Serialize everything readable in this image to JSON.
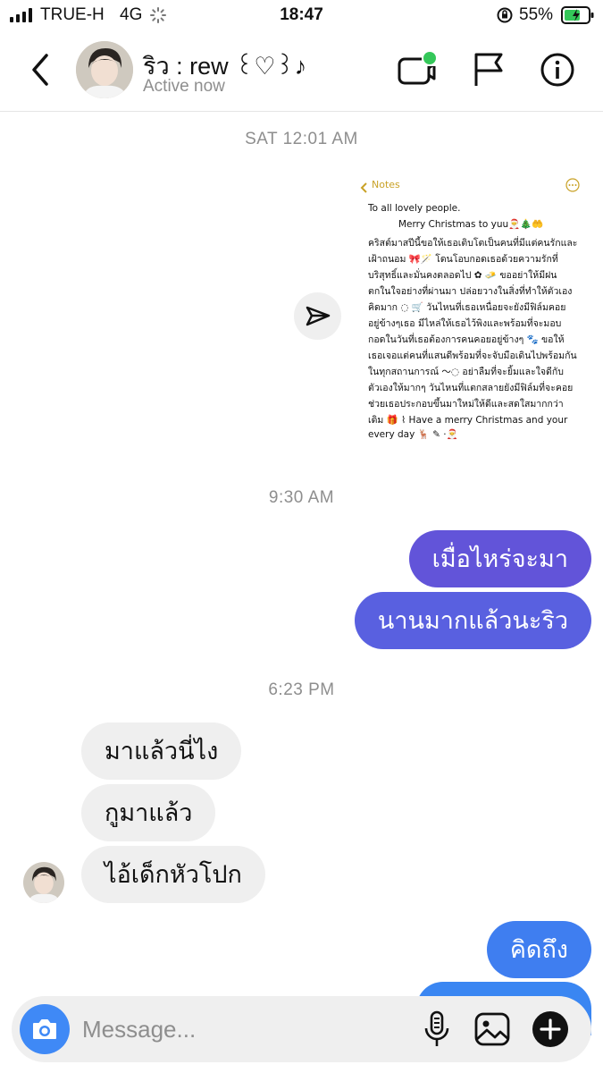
{
  "status_bar": {
    "carrier": "TRUE-H",
    "network": "4G",
    "time": "18:47",
    "battery": "55%"
  },
  "header": {
    "contact_name": "ริว : rew ꒰♡꒱♪",
    "status": "Active now"
  },
  "conversation": {
    "stamp_1": "SAT 12:01 AM",
    "shared_note": {
      "app_back_label": "Notes",
      "lines": [
        "To all lovely people.",
        "Merry Christmas to yuu🎅🎄🤲",
        "คริสต์มาสปีนี้ขอให้เธอเติบโตเป็นคนที่มีแต่คนรักและ",
        "เฝ้าถนอม 🎀🪄 โดนโอบกอดเธอด้วยความรักที่",
        "บริสุทธิ์และมั่นคงตลอดไป ✿ 🧈 ขออย่าให้มีฝน",
        "ตกในใจอย่างที่ผ่านมา ปล่อยวางในสิ่งที่ทำให้ตัวเอง",
        "คิดมาก ◌ 🛒 วันไหนที่เธอเหนื่อยจะยังมีฟิล์มคอย",
        "อยู่ข้างๆเธอ มีไหล่ให้เธอไว้พิงและพร้อมที่จะมอบ",
        "กอดในวันที่เธอต้องการคนคอยอยู่ข้างๆ 🐾 ขอให้",
        "เธอเจอแต่คนที่แสนดีพร้อมที่จะจับมือเดินไปพร้อมกัน",
        "ในทุกสถานการณ์ ～◌ อย่าลืมที่จะยิ้มและใจดีกับ",
        "ตัวเองให้มากๆ วันไหนที่แตกสลายยังมีฟิล์มที่จะคอย",
        "ช่วยเธอประกอบขึ้นมาใหม่ให้ดีและสดใสมากกว่า",
        "เดิม 🎁 ⌇ Have a merry Christmas and your",
        "every day 🦌 ✎ ·🎅"
      ]
    },
    "stamp_2": "9:30 AM",
    "outgoing_1": [
      "เมื่อไหร่จะมา",
      "นานมากแล้วนะริว"
    ],
    "stamp_3": "6:23 PM",
    "incoming": [
      "มาแล้วนี่ไง",
      "กูมาแล้ว",
      "ไอ้เด็กหัวโปก"
    ],
    "outgoing_2": [
      "คิดถึง"
    ]
  },
  "composer": {
    "placeholder": "Message..."
  },
  "colors": {
    "bubble_purple": "#5b51d8",
    "bubble_blue": "#3f7ef0",
    "active_dot": "#34c759"
  }
}
